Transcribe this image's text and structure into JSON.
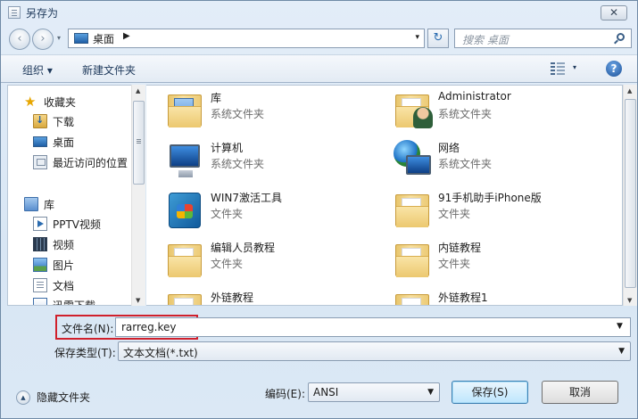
{
  "window": {
    "title": "另存为",
    "close": "✕"
  },
  "nav": {
    "back": "‹",
    "forward": "›",
    "dropdown": "▾"
  },
  "address": {
    "location": "桌面",
    "separator": "▶",
    "dropdown": "▾"
  },
  "refresh": "↻",
  "search": {
    "placeholder": "搜索 桌面"
  },
  "toolbar": {
    "organize": "组织 ▾",
    "new_folder": "新建文件夹",
    "view_dropdown": "▾",
    "help": "?"
  },
  "sidebar": {
    "favorites": "收藏夹",
    "items": [
      {
        "label": "下载",
        "icon": "download-folder-icon"
      },
      {
        "label": "桌面",
        "icon": "desktop-icon"
      },
      {
        "label": "最近访问的位置",
        "icon": "recent-places-icon"
      }
    ],
    "library": "库",
    "library_items": [
      {
        "label": "PPTV视频",
        "icon": "pptv-video-icon"
      },
      {
        "label": "视频",
        "icon": "video-icon"
      },
      {
        "label": "图片",
        "icon": "pictures-icon"
      },
      {
        "label": "文档",
        "icon": "documents-icon"
      },
      {
        "label": "迅雷下载",
        "icon": "xunlei-download-icon"
      }
    ]
  },
  "files": [
    {
      "name": "库",
      "type": "系统文件夹",
      "icon": "library-folder-icon"
    },
    {
      "name": "Administrator",
      "type": "系统文件夹",
      "icon": "user-folder-icon"
    },
    {
      "name": "计算机",
      "type": "系统文件夹",
      "icon": "computer-icon"
    },
    {
      "name": "网络",
      "type": "系统文件夹",
      "icon": "network-icon"
    },
    {
      "name": "WIN7激活工具",
      "type": "文件夹",
      "icon": "activation-tool-icon"
    },
    {
      "name": "91手机助手iPhone版",
      "type": "文件夹",
      "icon": "folder-icon"
    },
    {
      "name": "编辑人员教程",
      "type": "文件夹",
      "icon": "folder-icon"
    },
    {
      "name": "内链教程",
      "type": "文件夹",
      "icon": "folder-icon"
    },
    {
      "name": "外链教程",
      "type": "",
      "icon": "folder-icon"
    },
    {
      "name": "外链教程1",
      "type": "",
      "icon": "folder-icon"
    }
  ],
  "form": {
    "filename_label": "文件名(N):",
    "filename_value": "rarreg.key",
    "filetype_label": "保存类型(T):",
    "filetype_value": "文本文档(*.txt)",
    "hide_folders": "隐藏文件夹",
    "encoding_label": "编码(E):",
    "encoding_value": "ANSI",
    "save_button": "保存(S)",
    "cancel_button": "取消"
  },
  "colors": {
    "highlight_border": "#d0202c",
    "window_bg": "#dbe8f5"
  }
}
